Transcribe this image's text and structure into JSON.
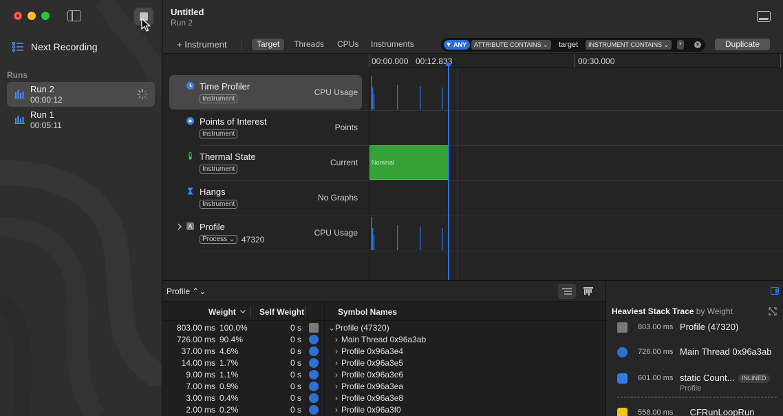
{
  "sidebar": {
    "next_recording": "Next Recording",
    "runs_label": "Runs",
    "runs": [
      {
        "name": "Run 2",
        "time": "00:00:12"
      },
      {
        "name": "Run 1",
        "time": "00:05:11"
      }
    ]
  },
  "header": {
    "title": "Untitled",
    "subtitle": "Run 2"
  },
  "toolbar": {
    "add_instrument": "+ Instrument",
    "segments": [
      "Target",
      "Threads",
      "CPUs",
      "Instruments"
    ],
    "filter": {
      "any": "ANY",
      "attr_chip": "ATTRIBUTE CONTAINS ⌄",
      "attr_value": "target",
      "instr_chip": "INSTRUMENT CONTAINS ⌄",
      "instr_value": "*"
    },
    "duplicate": "Duplicate"
  },
  "ruler": {
    "start": "00:00.000",
    "current": "00:12.833",
    "mark": "00:30.000"
  },
  "tracks": [
    {
      "name": "Time Profiler",
      "badge": "Instrument",
      "type": "CPU Usage"
    },
    {
      "name": "Points of Interest",
      "badge": "Instrument",
      "type": "Points"
    },
    {
      "name": "Thermal State",
      "badge": "Instrument",
      "type": "Current",
      "graph_label": "Nominal"
    },
    {
      "name": "Hangs",
      "badge": "Instrument",
      "type": "No Graphs"
    },
    {
      "name": "Profile",
      "badge": "Process ⌄",
      "pid": "47320",
      "type": "CPU Usage"
    }
  ],
  "bottom": {
    "selector": "Profile ⌃⌄",
    "columns": {
      "weight": "Weight",
      "self_weight": "Self Weight",
      "symbols": "Symbol Names"
    },
    "rows": [
      {
        "weight": "803.00 ms",
        "pct": "100.0%",
        "self": "0 s",
        "symbol": "Profile (47320)"
      },
      {
        "weight": "726.00 ms",
        "pct": "90.4%",
        "self": "0 s",
        "symbol": "Main Thread 0x96a3ab"
      },
      {
        "weight": "37.00 ms",
        "pct": "4.6%",
        "self": "0 s",
        "symbol": "Profile 0x96a3e4"
      },
      {
        "weight": "14.00 ms",
        "pct": "1.7%",
        "self": "0 s",
        "symbol": "Profile 0x96a3e5"
      },
      {
        "weight": "9.00 ms",
        "pct": "1.1%",
        "self": "0 s",
        "symbol": "Profile 0x96a3e6"
      },
      {
        "weight": "7.00 ms",
        "pct": "0.9%",
        "self": "0 s",
        "symbol": "Profile 0x96a3ea"
      },
      {
        "weight": "3.00 ms",
        "pct": "0.4%",
        "self": "0 s",
        "symbol": "Profile 0x96a3e8"
      },
      {
        "weight": "2.00 ms",
        "pct": "0.2%",
        "self": "0 s",
        "symbol": "Profile 0x96a3f0"
      }
    ]
  },
  "heaviest": {
    "title": "Heaviest Stack Trace",
    "by": "by Weight",
    "items": [
      {
        "ms": "803.00 ms",
        "name": "Profile (47320)"
      },
      {
        "ms": "726.00 ms",
        "name": "Main Thread 0x96a3ab"
      },
      {
        "ms": "601.00 ms",
        "name": "static Count...",
        "sub": "Profile",
        "tag": "INLINED"
      },
      {
        "ms": "558.00 ms",
        "name": "__CFRunLoopRun"
      }
    ]
  },
  "colors": {
    "accent": "#2f6fd8",
    "thermal": "#34a236",
    "close": "#ff5f57",
    "minimize": "#febc2e",
    "zoom": "#28c840"
  }
}
